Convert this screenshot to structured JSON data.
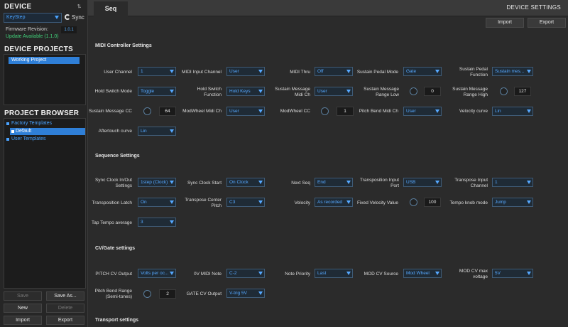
{
  "sidebar": {
    "device_title": "DEVICE",
    "device_select": "KeyStep",
    "sync_label": "Sync",
    "firmware_label": "Firmware Revision:",
    "firmware_value": "1.0.1",
    "update_text": "Update Available (1.1.0)",
    "projects_title": "DEVICE PROJECTS",
    "working_project": "Working Project",
    "browser_title": "PROJECT BROWSER",
    "tree": [
      "Factory Templates",
      "Default",
      "User Templates"
    ],
    "buttons": {
      "save": "Save",
      "save_as": "Save As...",
      "new": "New",
      "delete": "Delete",
      "import": "Import",
      "export": "Export"
    }
  },
  "top": {
    "tab": "Seq",
    "title": "DEVICE SETTINGS",
    "import": "Import",
    "export": "Export"
  },
  "midi": {
    "title": "MIDI Controller Settings",
    "user_channel": {
      "label": "User Channel",
      "value": "1"
    },
    "midi_input_channel": {
      "label": "MIDI Input Channel",
      "value": "User"
    },
    "midi_thru": {
      "label": "MIDI Thru",
      "value": "Off"
    },
    "sustain_pedal_mode": {
      "label": "Sustain Pedal Mode",
      "value": "Gate"
    },
    "sustain_pedal_function": {
      "label": "Sustain Pedal Function",
      "value": "Sustain mes..."
    },
    "hold_switch_mode": {
      "label": "Hold Switch Mode",
      "value": "Toggle"
    },
    "hold_switch_function": {
      "label": "Hold Switch Function",
      "value": "Hold Keys"
    },
    "sustain_midi_ch": {
      "label": "Sustain Message Midi Ch",
      "value": "User"
    },
    "sustain_range_low": {
      "label": "Sustain Message Range Low",
      "value": "0"
    },
    "sustain_range_high": {
      "label": "Sustain Message Range High",
      "value": "127"
    },
    "sustain_cc": {
      "label": "Sustain Message CC",
      "value": "64"
    },
    "modwheel_midi_ch": {
      "label": "ModWheel Midi Ch",
      "value": "User"
    },
    "modwheel_cc": {
      "label": "ModWheel CC",
      "value": "1"
    },
    "pitch_bend_midi_ch": {
      "label": "Pitch Bend Midi Ch",
      "value": "User"
    },
    "velocity_curve": {
      "label": "Velocity curve",
      "value": "Lin"
    },
    "aftertouch_curve": {
      "label": "Aftertouch curve",
      "value": "Lin"
    }
  },
  "seq": {
    "title": "Sequence Settings",
    "sync_clock": {
      "label": "Sync Clock In/Out Settings",
      "value": "1step (Clock)"
    },
    "sync_clock_start": {
      "label": "Sync Clock Start",
      "value": "On Clock"
    },
    "next_seq": {
      "label": "Next Seq",
      "value": "End"
    },
    "transposition_input_port": {
      "label": "Transposition Input Port",
      "value": "USB"
    },
    "transpose_input_channel": {
      "label": "Transpose Input Channel",
      "value": "1"
    },
    "transposition_latch": {
      "label": "Transposition Latch",
      "value": "On"
    },
    "transpose_center_pitch": {
      "label": "Transpose Center Pitch",
      "value": "C3"
    },
    "velocity": {
      "label": "Velocity",
      "value": "As recorded"
    },
    "fixed_velocity": {
      "label": "Fixed Velocity Value",
      "value": "100"
    },
    "tempo_knob_mode": {
      "label": "Tempo knob mode",
      "value": "Jump"
    },
    "tap_tempo": {
      "label": "Tap Tempo average",
      "value": "3"
    }
  },
  "cv": {
    "title": "CV/Gate settings",
    "pitch_cv_output": {
      "label": "PITCH CV Output",
      "value": "Volts per oc..."
    },
    "zero_v_midi_note": {
      "label": "0V MIDI Note",
      "value": "C-2"
    },
    "note_priority": {
      "label": "Note Priority",
      "value": "Last"
    },
    "mod_cv_source": {
      "label": "MOD CV Source",
      "value": "Mod Wheel"
    },
    "mod_cv_max": {
      "label": "MOD CV max voltage",
      "value": "5V"
    },
    "pitch_bend_range": {
      "label": "Pitch Bend Range (Semi-tones)",
      "value": "2"
    },
    "gate_cv_output": {
      "label": "GATE CV Output",
      "value": "V-trig 5V"
    }
  },
  "transport": {
    "title": "Transport settings"
  }
}
